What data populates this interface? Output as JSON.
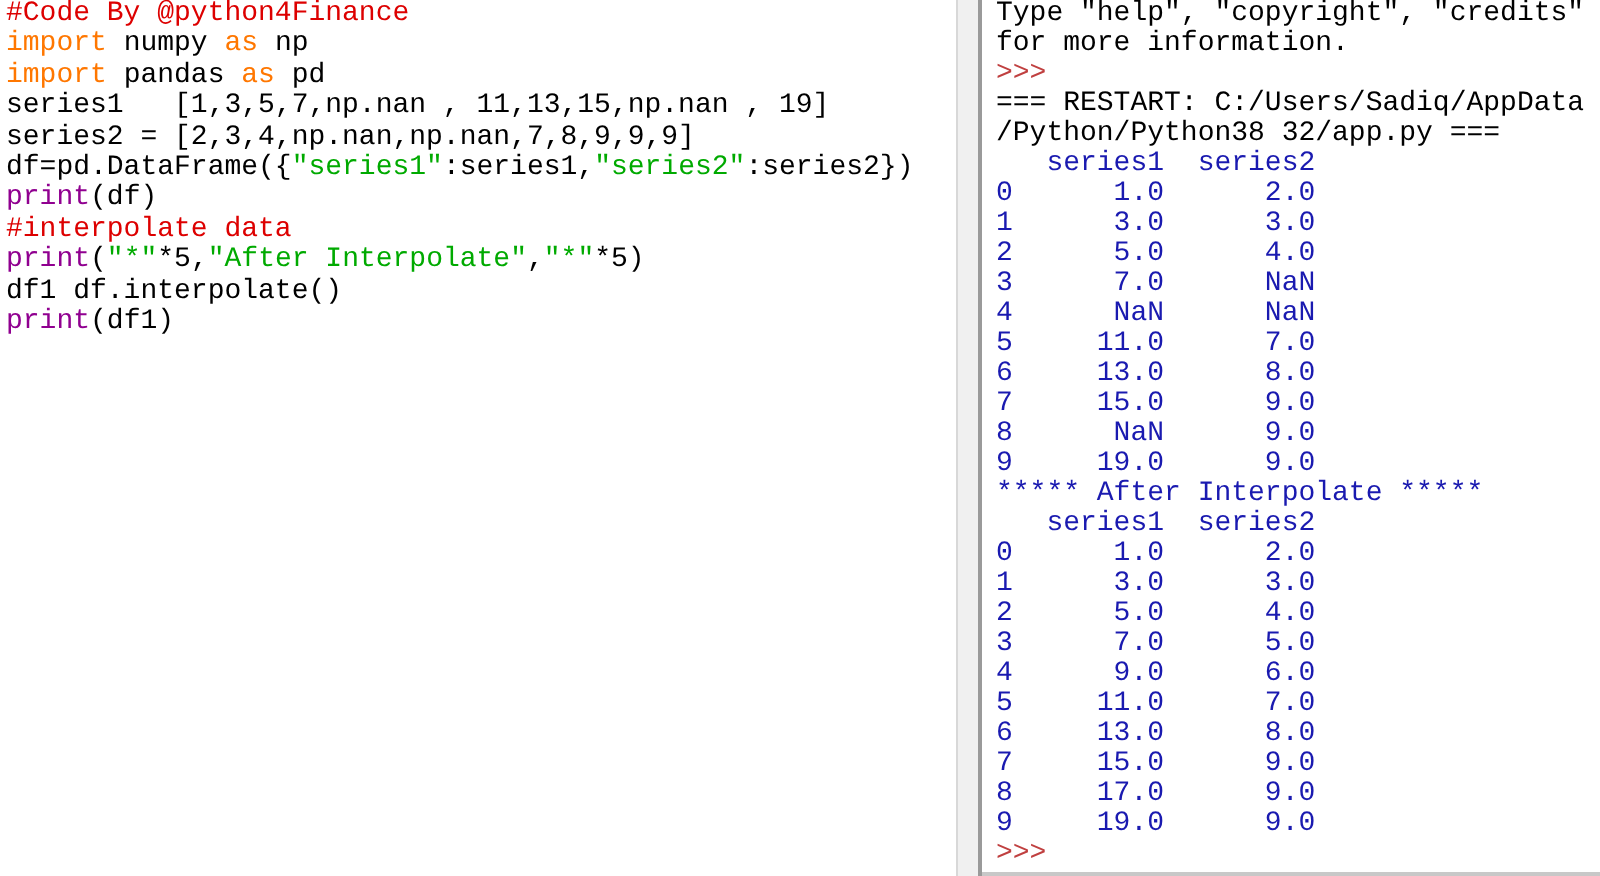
{
  "editor": {
    "lines": [
      [
        {
          "kind": "comment",
          "text": "#Code By @python4Finance"
        }
      ],
      [
        {
          "kind": "keyword",
          "text": "import"
        },
        {
          "kind": "plain",
          "text": " numpy "
        },
        {
          "kind": "keyword",
          "text": "as"
        },
        {
          "kind": "plain",
          "text": " np"
        }
      ],
      [
        {
          "kind": "keyword",
          "text": "import"
        },
        {
          "kind": "plain",
          "text": " pandas "
        },
        {
          "kind": "keyword",
          "text": "as"
        },
        {
          "kind": "plain",
          "text": " pd"
        }
      ],
      [
        {
          "kind": "plain",
          "text": "series1   [1,3,5,7,np.nan , 11,13,15,np.nan , 19]"
        }
      ],
      [
        {
          "kind": "plain",
          "text": "series2 = [2,3,4,np.nan,np.nan,7,8,9,9,9]"
        }
      ],
      [
        {
          "kind": "plain",
          "text": "df=pd.DataFrame({"
        },
        {
          "kind": "string",
          "text": "\"series1\""
        },
        {
          "kind": "plain",
          "text": ":series1,"
        },
        {
          "kind": "string",
          "text": "\"series2\""
        },
        {
          "kind": "plain",
          "text": ":series2})"
        }
      ],
      [
        {
          "kind": "builtin",
          "text": "print"
        },
        {
          "kind": "plain",
          "text": "(df)"
        }
      ],
      [
        {
          "kind": "comment",
          "text": "#interpolate data"
        }
      ],
      [
        {
          "kind": "builtin",
          "text": "print"
        },
        {
          "kind": "plain",
          "text": "("
        },
        {
          "kind": "string",
          "text": "\"*\""
        },
        {
          "kind": "plain",
          "text": "*5,"
        },
        {
          "kind": "string",
          "text": "\"After Interpolate\""
        },
        {
          "kind": "plain",
          "text": ","
        },
        {
          "kind": "string",
          "text": "\"*\""
        },
        {
          "kind": "plain",
          "text": "*5)"
        }
      ],
      [
        {
          "kind": "plain",
          "text": "df1 df.interpolate()"
        }
      ],
      [
        {
          "kind": "builtin",
          "text": "print"
        },
        {
          "kind": "plain",
          "text": "(df1)"
        }
      ]
    ]
  },
  "shell": {
    "lines": [
      {
        "kind": "info",
        "text": "Type \"help\", \"copyright\", \"credits\""
      },
      {
        "kind": "info",
        "text": "for more information."
      },
      {
        "kind": "prompt",
        "text": ">>>"
      },
      {
        "kind": "info",
        "text": "=== RESTART: C:/Users/Sadiq/AppData"
      },
      {
        "kind": "info",
        "text": "/Python/Python38 32/app.py ==="
      },
      {
        "kind": "output",
        "text": "   series1  series2"
      },
      {
        "kind": "output",
        "text": "0      1.0      2.0"
      },
      {
        "kind": "output",
        "text": "1      3.0      3.0"
      },
      {
        "kind": "output",
        "text": "2      5.0      4.0"
      },
      {
        "kind": "output",
        "text": "3      7.0      NaN"
      },
      {
        "kind": "output",
        "text": "4      NaN      NaN"
      },
      {
        "kind": "output",
        "text": "5     11.0      7.0"
      },
      {
        "kind": "output",
        "text": "6     13.0      8.0"
      },
      {
        "kind": "output",
        "text": "7     15.0      9.0"
      },
      {
        "kind": "output",
        "text": "8      NaN      9.0"
      },
      {
        "kind": "output",
        "text": "9     19.0      9.0"
      },
      {
        "kind": "output",
        "text": "***** After Interpolate *****"
      },
      {
        "kind": "output",
        "text": "   series1  series2"
      },
      {
        "kind": "output",
        "text": "0      1.0      2.0"
      },
      {
        "kind": "output",
        "text": "1      3.0      3.0"
      },
      {
        "kind": "output",
        "text": "2      5.0      4.0"
      },
      {
        "kind": "output",
        "text": "3      7.0      5.0"
      },
      {
        "kind": "output",
        "text": "4      9.0      6.0"
      },
      {
        "kind": "output",
        "text": "5     11.0      7.0"
      },
      {
        "kind": "output",
        "text": "6     13.0      8.0"
      },
      {
        "kind": "output",
        "text": "7     15.0      9.0"
      },
      {
        "kind": "output",
        "text": "8     17.0      9.0"
      },
      {
        "kind": "output",
        "text": "9     19.0      9.0"
      },
      {
        "kind": "prompt",
        "text": ">>>"
      }
    ]
  }
}
